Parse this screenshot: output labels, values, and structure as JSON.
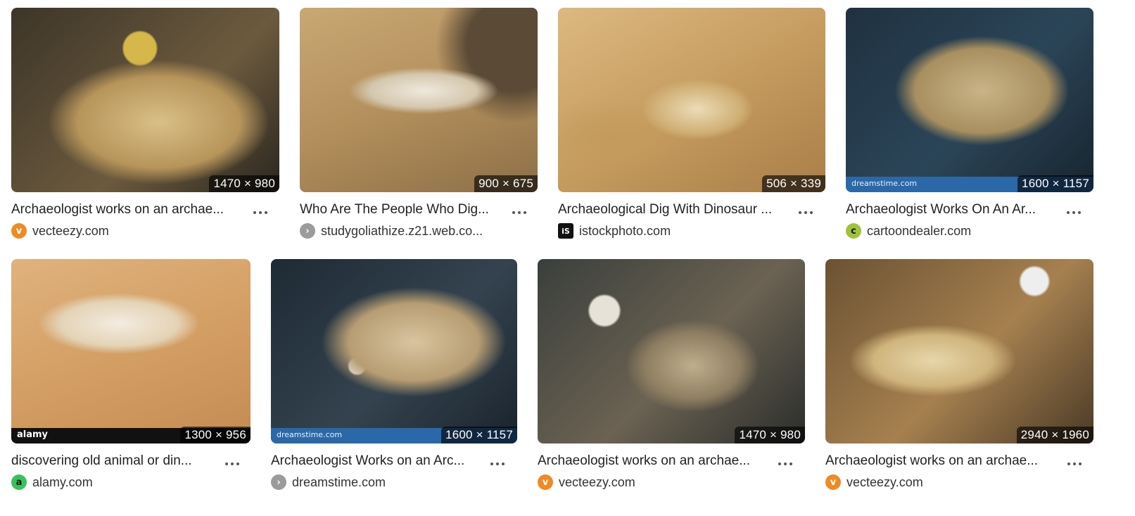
{
  "results": [
    {
      "title": "Archaeologist works on an archae...",
      "domain": "vecteezy.com",
      "dims": "1470 × 980",
      "fav_icon": "vecteezy-icon",
      "fav_glyph": "v",
      "fav_color": "#f08a24"
    },
    {
      "title": "Who Are The People Who Dig...",
      "domain": "studygoliathize.z21.web.co...",
      "dims": "900 × 675",
      "fav_icon": "chevron-right-icon",
      "fav_glyph": "›",
      "fav_color": "#9b9b9b"
    },
    {
      "title": "Archaeological Dig With Dinosaur ...",
      "domain": "istockphoto.com",
      "dims": "506 × 339",
      "fav_icon": "istock-icon",
      "fav_glyph": "iS",
      "fav_color": "#111111"
    },
    {
      "title": "Archaeologist Works On An Ar...",
      "domain": "cartoondealer.com",
      "dims": "1600 × 1157",
      "fav_icon": "cartoondealer-icon",
      "fav_glyph": "c",
      "fav_color": "#9ec33c",
      "ribbon": "dreamstime.com"
    },
    {
      "title": "discovering old animal or din...",
      "domain": "alamy.com",
      "dims": "1300 × 956",
      "fav_icon": "alamy-icon",
      "fav_glyph": "a",
      "fav_color": "#38c25a",
      "ribbon": "alamy"
    },
    {
      "title": "Archaeologist Works on an Arc...",
      "domain": "dreamstime.com",
      "dims": "1600 × 1157",
      "fav_icon": "chevron-right-icon",
      "fav_glyph": "›",
      "fav_color": "#9b9b9b",
      "ribbon": "dreamstime.com"
    },
    {
      "title": "Archaeologist works on an archae...",
      "domain": "vecteezy.com",
      "dims": "1470 × 980",
      "fav_icon": "vecteezy-icon",
      "fav_glyph": "v",
      "fav_color": "#f08a24"
    },
    {
      "title": "Archaeologist works on an archae...",
      "domain": "vecteezy.com",
      "dims": "2940 × 1960",
      "fav_icon": "vecteezy-icon",
      "fav_glyph": "v",
      "fav_color": "#f08a24"
    }
  ]
}
